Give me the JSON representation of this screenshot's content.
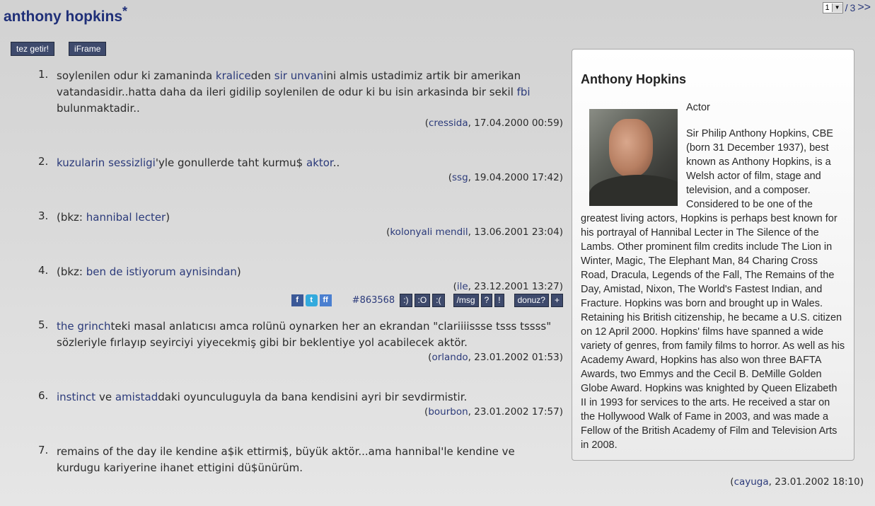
{
  "header": {
    "title": "anthony hopkins",
    "title_mark": "*"
  },
  "pager": {
    "current": "1",
    "separator": "/",
    "total": "3",
    "next": ">>"
  },
  "toolbar": {
    "tez_label": "tez getir!",
    "iframe_label": "iFrame"
  },
  "entries": [
    {
      "num": "1.",
      "segments": [
        {
          "t": "soylenilen odur ki zamaninda ",
          "l": false
        },
        {
          "t": "kralice",
          "l": true
        },
        {
          "t": "den ",
          "l": false
        },
        {
          "t": "sir unvan",
          "l": true
        },
        {
          "t": "ini almis ustadimiz artik bir amerikan vatandasidir..hatta daha da ileri gidilip soylenilen de odur ki bu isin arkasinda bir sekil ",
          "l": false
        },
        {
          "t": "fbi",
          "l": true
        },
        {
          "t": " bulunmaktadir..",
          "l": false
        }
      ],
      "author": "cressida",
      "date": ", 17.04.2000 00:59"
    },
    {
      "num": "2.",
      "segments": [
        {
          "t": "kuzularin sessizligi",
          "l": true
        },
        {
          "t": "'yle gonullerde taht kurmu$ ",
          "l": false
        },
        {
          "t": "aktor",
          "l": true
        },
        {
          "t": "..",
          "l": false
        }
      ],
      "author": "ssg",
      "date": ", 19.04.2000 17:42"
    },
    {
      "num": "3.",
      "segments": [
        {
          "t": "(bkz: ",
          "l": false
        },
        {
          "t": "hannibal lecter",
          "l": true
        },
        {
          "t": ")",
          "l": false
        }
      ],
      "author": "kolonyali mendil",
      "date": ", 13.06.2001 23:04"
    },
    {
      "num": "4.",
      "segments": [
        {
          "t": "(bkz: ",
          "l": false
        },
        {
          "t": "ben de istiyorum aynisindan",
          "l": true
        },
        {
          "t": ")",
          "l": false
        }
      ],
      "author": "ile",
      "date": ", 23.12.2001 13:27",
      "tools": {
        "entry_id": "#863568",
        "smile": ":)",
        "oh": ":O",
        "sad": ":(",
        "msg": "/msg",
        "q": "?",
        "excl": "!",
        "donuz": "donuz?",
        "plus": "+"
      }
    },
    {
      "num": "5.",
      "segments": [
        {
          "t": "the grinch",
          "l": true
        },
        {
          "t": "teki masal anlatıcısı amca rolünü oynarken her an ekrandan \"clariiiissse tsss tssss\" sözleriyle fırlayıp seyirciyi yiyecekmiş gibi bir beklentiye yol acabilecek aktör.",
          "l": false
        }
      ],
      "author": "orlando",
      "date": ", 23.01.2002 01:53"
    },
    {
      "num": "6.",
      "segments": [
        {
          "t": "instinct",
          "l": true
        },
        {
          "t": " ve ",
          "l": false
        },
        {
          "t": "amistad",
          "l": true
        },
        {
          "t": "daki oyunculuguyla da bana kendisini ayri bir sevdirmistir.",
          "l": false
        }
      ],
      "author": "bourbon",
      "date": ", 23.01.2002 17:57"
    },
    {
      "num": "7.",
      "segments": [
        {
          "t": "remains of the day ile kendine a$ik ettirmi$, büyük aktör...ama hannibal'le kendine ve kurdugu kariyerine ihanet ettigini dü$ünürüm.",
          "l": false
        }
      ],
      "author": "cayuga",
      "date": ", 23.01.2002 18:10"
    }
  ],
  "sidebar": {
    "title": "Anthony Hopkins",
    "role": "Actor",
    "bio": "Sir Philip Anthony Hopkins, CBE (born 31 December 1937), best known as Anthony Hopkins, is a Welsh actor of film, stage and television, and a composer. Considered to be one of the greatest living actors, Hopkins is perhaps best known for his portrayal of Hannibal Lecter in The Silence of the Lambs. Other prominent film credits include The Lion in Winter, Magic, The Elephant Man, 84 Charing Cross Road, Dracula, Legends of the Fall, The Remains of the Day, Amistad, Nixon, The World's Fastest Indian, and Fracture. Hopkins was born and brought up in Wales. Retaining his British citizenship, he became a U.S. citizen on 12 April 2000. Hopkins' films have spanned a wide variety of genres, from family films to horror. As well as his Academy Award, Hopkins has also won three BAFTA Awards, two Emmys and the Cecil B. DeMille Golden Globe Award. Hopkins was knighted by Queen Elizabeth II in 1993 for services to the arts. He received a star on the Hollywood Walk of Fame in 2003, and was made a Fellow of the British Academy of Film and Television Arts in 2008."
  },
  "icons": {
    "facebook": "facebook-icon",
    "twitter": "twitter-icon",
    "friendfeed": "friendfeed-icon",
    "photo": "actor-photo"
  },
  "colors": {
    "link": "#2b3a7a",
    "button": "#3e4a6c",
    "title": "#1f2f78"
  }
}
